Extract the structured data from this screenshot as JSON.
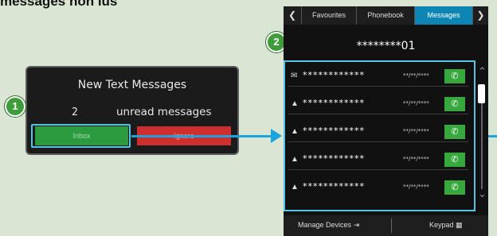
{
  "heading": "messages non lus",
  "popup": {
    "title": "New Text Messages",
    "count": "2",
    "count_label": "unread messages",
    "inbox_label": "Inbox",
    "ignore_label": "Ignore"
  },
  "steps": [
    "1",
    "2"
  ],
  "screen": {
    "tabs": [
      {
        "label": "Favourites",
        "active": false
      },
      {
        "label": "Phonebook",
        "active": false
      },
      {
        "label": "Messages",
        "active": true
      }
    ],
    "contact": "********01",
    "messages": [
      {
        "name": "************",
        "date": "**/**/****",
        "read": false
      },
      {
        "name": "************",
        "date": "**/**/****",
        "read": true
      },
      {
        "name": "************",
        "date": "**/**/****",
        "read": true
      },
      {
        "name": "************",
        "date": "**/**/****",
        "read": true
      },
      {
        "name": "************",
        "date": "**/**/****",
        "read": true
      }
    ],
    "manage_devices": "Manage Devices",
    "keypad": "Keypad"
  },
  "colors": {
    "background": "#d9e6d3",
    "highlight": "#56c3e8",
    "accent_green": "#37a83d",
    "active_tab": "#0e86b5",
    "ignore_red": "#cf2e2e"
  },
  "icons": [
    "envelope-icon",
    "opened-envelope-icon",
    "phone-icon",
    "scroll-up-icon",
    "scroll-down-icon",
    "chevron-left-icon",
    "chevron-right-icon",
    "device-icon",
    "keypad-icon"
  ]
}
